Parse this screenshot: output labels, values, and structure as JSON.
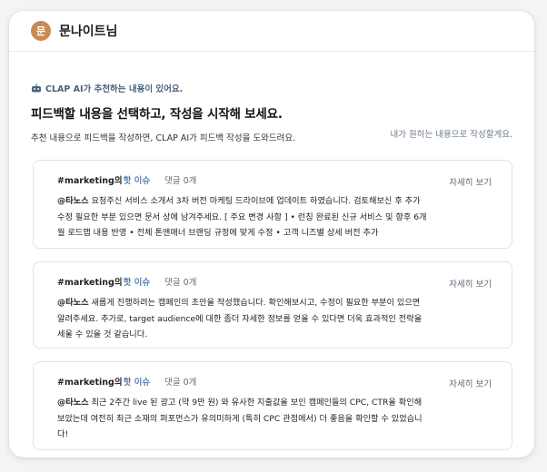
{
  "header": {
    "avatar_initial": "문",
    "user_name": "문나이트님"
  },
  "intro": {
    "ai_notice": "CLAP AI가 추천하는 내용이 있어요.",
    "headline": "피드백할 내용을 선택하고, 작성을 시작해 보세요.",
    "subtext": "추천 내용으로 피드백을 작성하면, CLAP AI가 피드백 작성을 도와드려요.",
    "self_write_link": "내가 원하는 내용으로 작성할게요."
  },
  "cards": [
    {
      "tag": "#marketing의",
      "hot": "핫 이슈",
      "comments": "댓글 0개",
      "mention": "@타노스",
      "body": " 요청주신 서비스 소개서 3차 버전 마케팅 드라이브에 업데이트 하였습니다. 검토해보신 후 추가 수정 필요한 부분 있으면 문서 상에 남겨주세요. [ 주요 변경 사항 ] • 런칭 완료된 신규 서비스 및 향후 6개월 로드맵 내용 반영 • 전체 톤앤매너 브랜딩 규정에 맞게 수정 • 고객 니즈별 상세 버전 추가",
      "view_more": "자세히 보기"
    },
    {
      "tag": "#marketing의",
      "hot": "핫 이슈",
      "comments": "댓글 0개",
      "mention": "@타노스",
      "body": " 새롭게 진행하려는 캠페인의 초안을 작성했습니다. 확인해보시고, 수정이 필요한 부분이 있으면 알려주세요. 추가로, target audience에 대한 좀더 자세한 정보를 얻을 수 있다면 더욱 효과적인 전략을 세울 수 있을 것 같습니다.",
      "view_more": "자세히 보기"
    },
    {
      "tag": "#marketing의",
      "hot": "핫 이슈",
      "comments": "댓글 0개",
      "mention": "@타노스",
      "body": " 최근 2주간 live 된 광고 (약 9만 원) 와 유사한 지출값을 보인 캠페인들의 CPC, CTR을 확인해 보았는데 여전히 최근 소재의 퍼포먼스가 유의미하게 (특히 CPC 관점에서) 더 좋음을 확인할 수 있었습니다!",
      "view_more": "자세히 보기"
    }
  ]
}
